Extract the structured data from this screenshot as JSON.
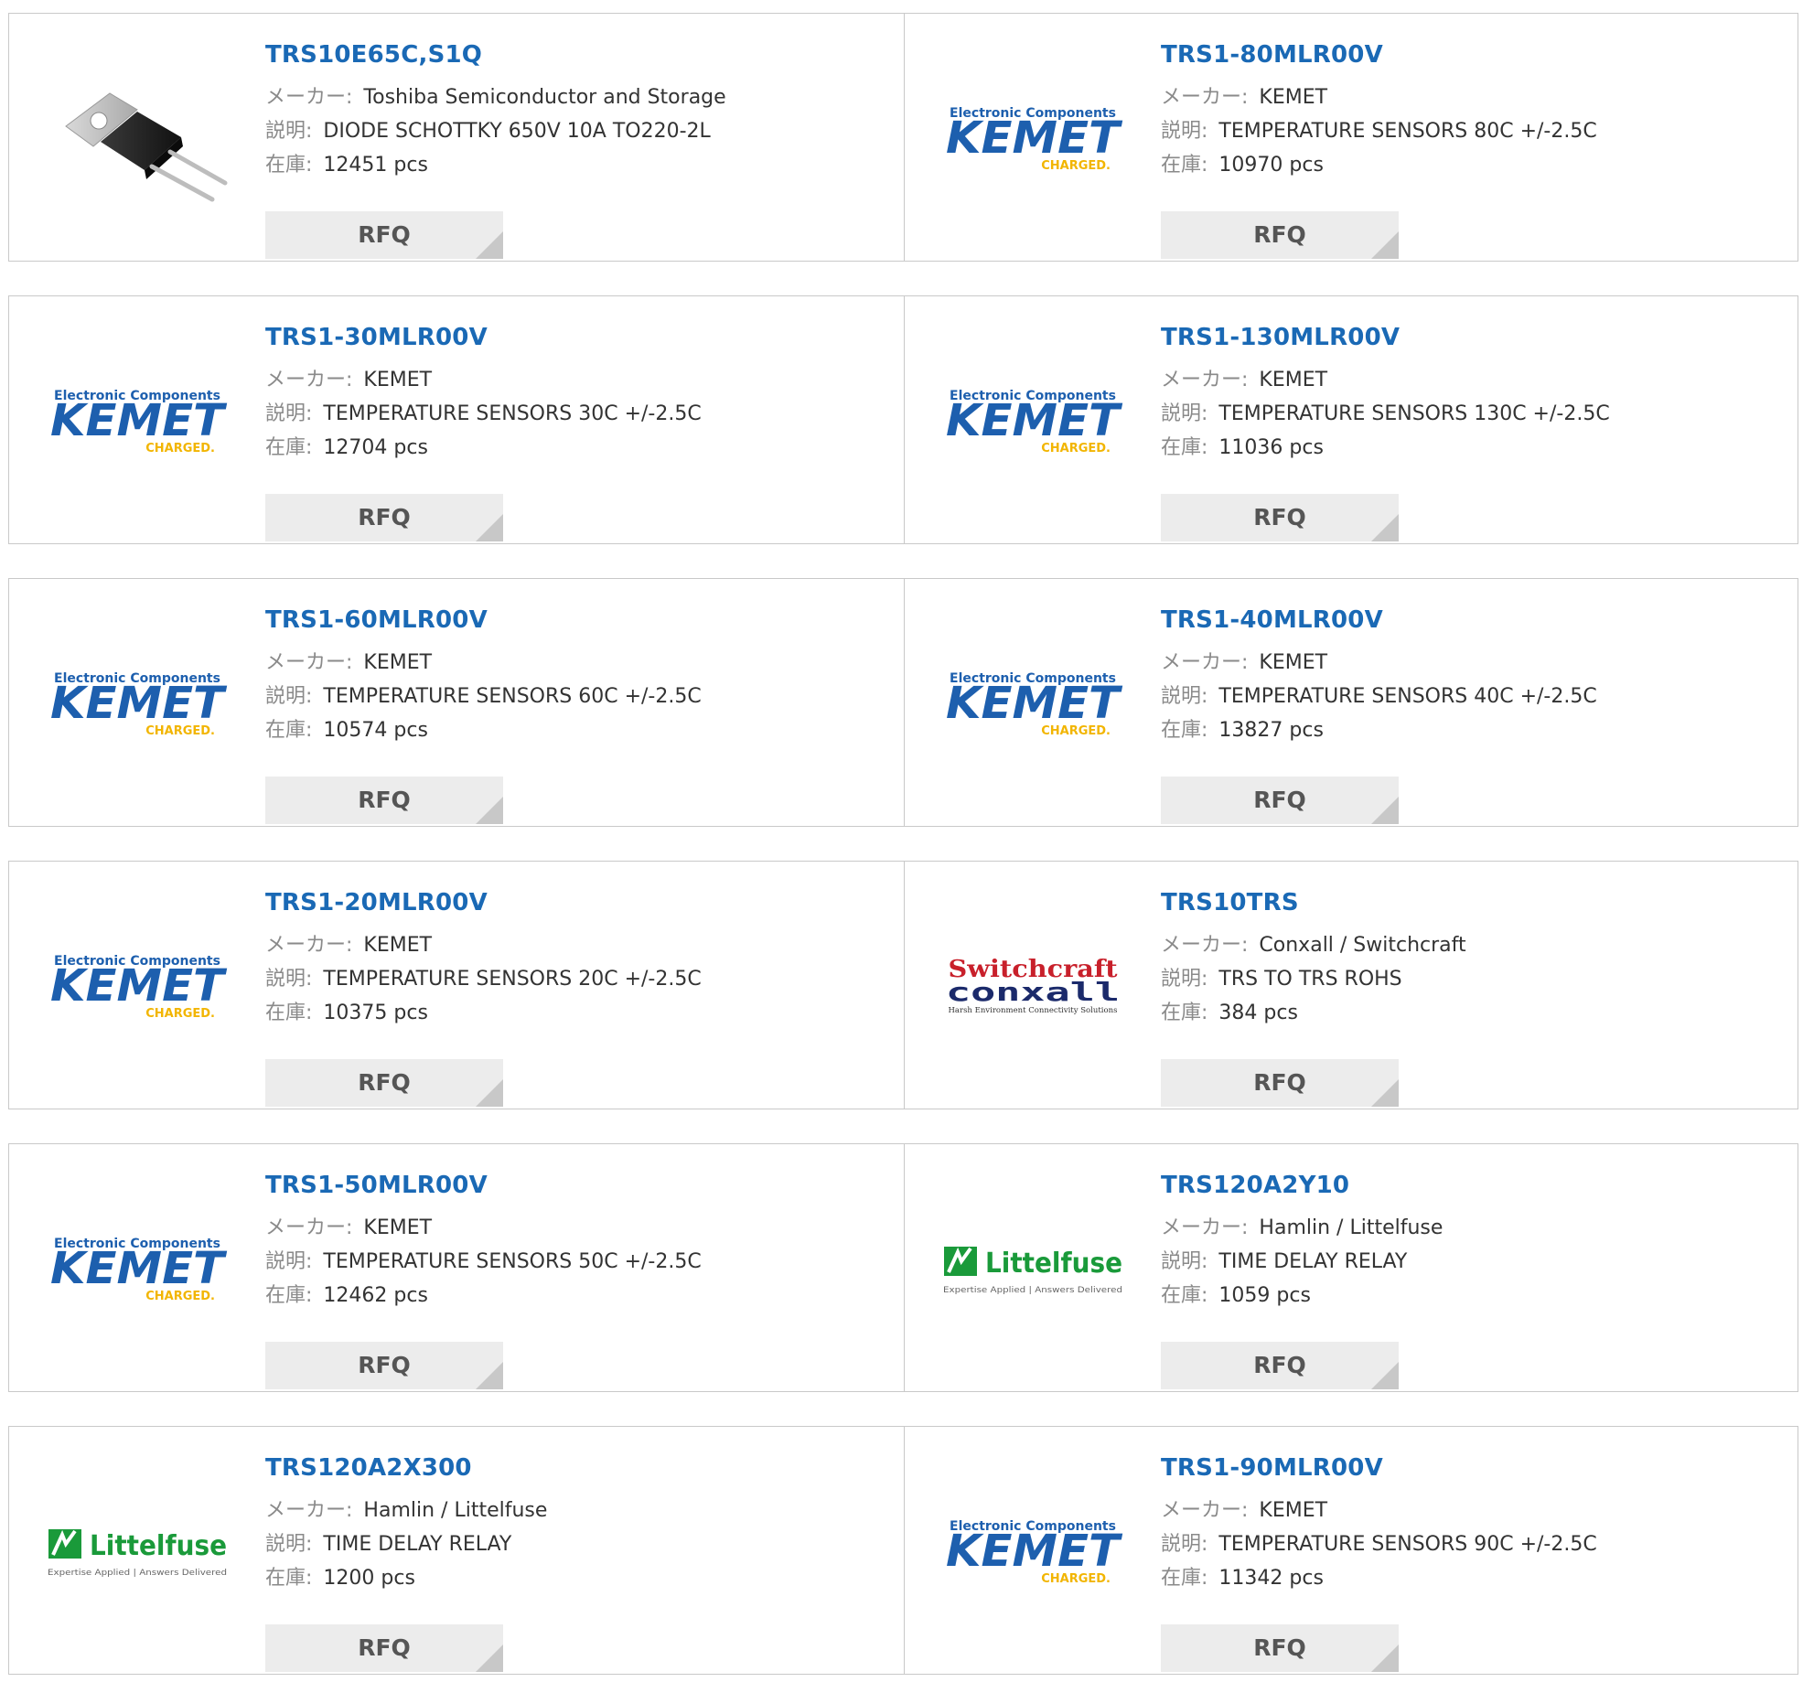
{
  "labels": {
    "maker": "メーカー:",
    "description": "説明:",
    "stock": "在庫:"
  },
  "products": [
    {
      "part": "TRS10E65C,S1Q",
      "maker": "Toshiba Semiconductor and Storage",
      "description": "DIODE SCHOTTKY 650V 10A TO220-2L",
      "stock": "12451 pcs",
      "rfq": "RFQ",
      "image": "to220-diode-photo"
    },
    {
      "part": "TRS1-80MLR00V",
      "maker": "KEMET",
      "description": "TEMPERATURE SENSORS 80C +/-2.5C",
      "stock": "10970 pcs",
      "rfq": "RFQ",
      "image": "kemet-logo"
    },
    {
      "part": "TRS1-30MLR00V",
      "maker": "KEMET",
      "description": "TEMPERATURE SENSORS 30C +/-2.5C",
      "stock": "12704 pcs",
      "rfq": "RFQ",
      "image": "kemet-logo"
    },
    {
      "part": "TRS1-130MLR00V",
      "maker": "KEMET",
      "description": "TEMPERATURE SENSORS 130C +/-2.5C",
      "stock": "11036 pcs",
      "rfq": "RFQ",
      "image": "kemet-logo"
    },
    {
      "part": "TRS1-60MLR00V",
      "maker": "KEMET",
      "description": "TEMPERATURE SENSORS 60C +/-2.5C",
      "stock": "10574 pcs",
      "rfq": "RFQ",
      "image": "kemet-logo"
    },
    {
      "part": "TRS1-40MLR00V",
      "maker": "KEMET",
      "description": "TEMPERATURE SENSORS 40C +/-2.5C",
      "stock": "13827 pcs",
      "rfq": "RFQ",
      "image": "kemet-logo"
    },
    {
      "part": "TRS1-20MLR00V",
      "maker": "KEMET",
      "description": "TEMPERATURE SENSORS 20C +/-2.5C",
      "stock": "10375 pcs",
      "rfq": "RFQ",
      "image": "kemet-logo"
    },
    {
      "part": "TRS10TRS",
      "maker": "Conxall / Switchcraft",
      "description": "TRS TO TRS ROHS",
      "stock": "384 pcs",
      "rfq": "RFQ",
      "image": "switchcraft-conxall-logo"
    },
    {
      "part": "TRS1-50MLR00V",
      "maker": "KEMET",
      "description": "TEMPERATURE SENSORS 50C +/-2.5C",
      "stock": "12462 pcs",
      "rfq": "RFQ",
      "image": "kemet-logo"
    },
    {
      "part": "TRS120A2Y10",
      "maker": "Hamlin / Littelfuse",
      "description": "TIME DELAY RELAY",
      "stock": "1059 pcs",
      "rfq": "RFQ",
      "image": "littelfuse-logo"
    },
    {
      "part": "TRS120A2X300",
      "maker": "Hamlin / Littelfuse",
      "description": "TIME DELAY RELAY",
      "stock": "1200 pcs",
      "rfq": "RFQ",
      "image": "littelfuse-logo"
    },
    {
      "part": "TRS1-90MLR00V",
      "maker": "KEMET",
      "description": "TEMPERATURE SENSORS 90C +/-2.5C",
      "stock": "11342 pcs",
      "rfq": "RFQ",
      "image": "kemet-logo"
    }
  ],
  "logo_text": {
    "kemet": {
      "top": "Electronic Components",
      "main": "KEMET",
      "tag": "CHARGED."
    },
    "switchcraft": {
      "top": "Switchcraft",
      "main": "conxall",
      "tag": "Harsh Environment Connectivity Solutions"
    },
    "littelfuse": {
      "main": "Littelfuse",
      "tag": "Expertise Applied | Answers Delivered"
    }
  },
  "colors": {
    "link": "#1a69b5",
    "kemet_blue": "#1d5fae",
    "kemet_gold": "#f2b500",
    "switchcraft_red": "#c8202b",
    "conxall_navy": "#1b2a6b",
    "littelfuse_green": "#1a9a3a",
    "rfq_bg": "#ececec",
    "border": "#c9c9c9"
  }
}
